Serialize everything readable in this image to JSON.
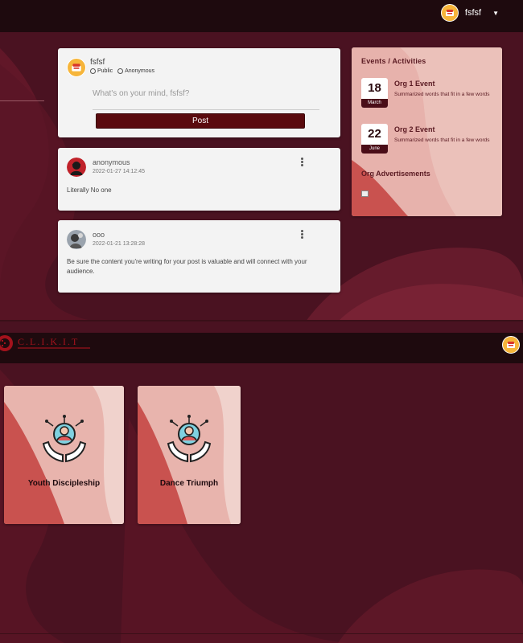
{
  "colors": {
    "background": "#4a1221",
    "nav": "#1e0a0e",
    "card": "#f3f3f3",
    "accent": "#5a0a0e",
    "panel": "#e7b2ac"
  },
  "top_nav": {
    "username": "fsfsf",
    "dropdown_icon": "caret-down-icon"
  },
  "composer": {
    "username": "fsfsf",
    "visibility_options": [
      "Public",
      "Anonymous"
    ],
    "placeholder": "What's on your mind, fsfsf?",
    "post_label": "Post"
  },
  "posts": [
    {
      "author": "anonymous",
      "date": "2022-01-27 14:12:45",
      "body": "Literally No one"
    },
    {
      "author": "ooo",
      "date": "2022-01-21 13:28:28",
      "body": "Be sure the content you're writing for your post is valuable and will connect with your audience."
    }
  ],
  "events": {
    "title": "Events / Activities",
    "items": [
      {
        "day": "18",
        "month": "March",
        "name": "Org 1 Event",
        "desc": "Summarized words that fit in a few words"
      },
      {
        "day": "22",
        "month": "June",
        "name": "Org 2 Event",
        "desc": "Summarized words that fit in a few words"
      }
    ],
    "ads_title": "Org Advertisements"
  },
  "second_nav": {
    "logo": "C.L.I.K.I.T"
  },
  "orgs": [
    {
      "name": "Youth Discipleship"
    },
    {
      "name": "Dance Triumph"
    }
  ]
}
